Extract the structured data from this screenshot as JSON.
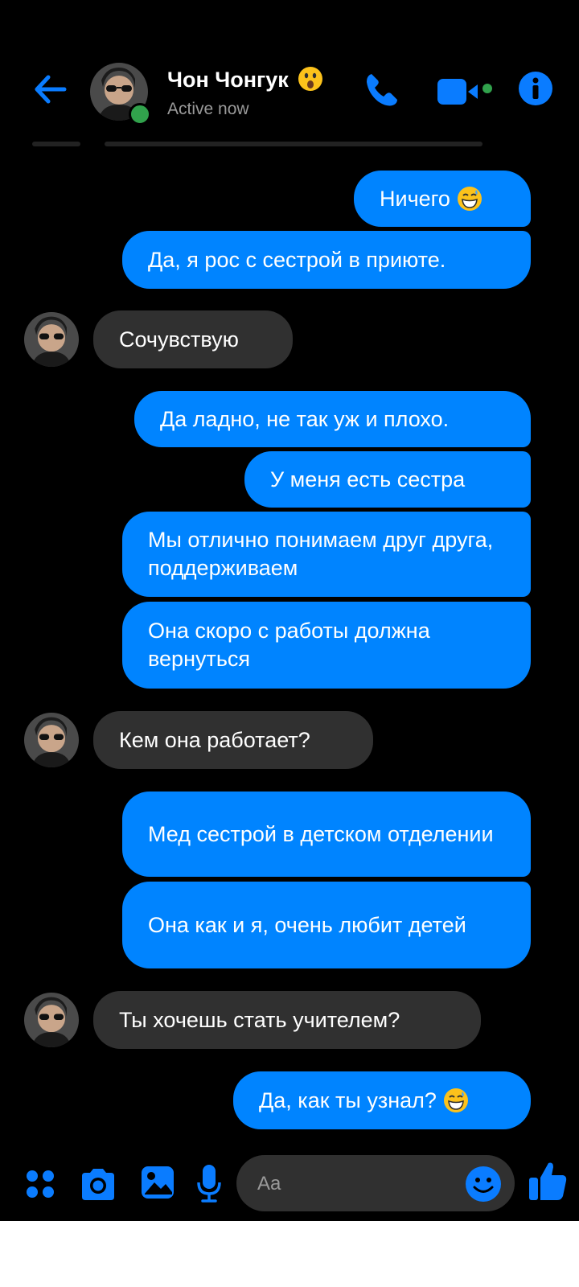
{
  "header": {
    "contact_name": "Чон Чонгук",
    "status": "Active now"
  },
  "messages": [
    {
      "side": "out",
      "text": "Ничего",
      "emoji": "grinning-sweat-emoji"
    },
    {
      "side": "out",
      "text": "Да, я рос с сестрой в приюте."
    },
    {
      "side": "in",
      "text": "Сочувствую"
    },
    {
      "side": "out",
      "text": "Да ладно, не так уж и плохо."
    },
    {
      "side": "out",
      "text": "У меня есть сестра"
    },
    {
      "side": "out",
      "text": "Мы отлично понимаем друг друга, поддерживаем"
    },
    {
      "side": "out",
      "text": "Она скоро с работы должна вернуться"
    },
    {
      "side": "in",
      "text": "Кем она работает?"
    },
    {
      "side": "out",
      "text": "Мед сестрой в детском отделении"
    },
    {
      "side": "out",
      "text": "Она как и я, очень любит детей"
    },
    {
      "side": "in",
      "text": "Ты хочешь стать учителем?"
    },
    {
      "side": "out",
      "text": "Да, как ты узнал?",
      "emoji": "grinning-sweat-emoji"
    }
  ],
  "composer": {
    "placeholder": "Aa"
  },
  "colors": {
    "accent": "#0084ff",
    "background": "#000000",
    "incoming_bubble": "#303030",
    "online": "#31a24c"
  },
  "icons": [
    "back-arrow-icon",
    "phone-icon",
    "video-camera-icon",
    "info-icon",
    "apps-icon",
    "camera-icon",
    "gallery-icon",
    "microphone-icon",
    "smiley-icon",
    "thumbs-up-icon"
  ]
}
